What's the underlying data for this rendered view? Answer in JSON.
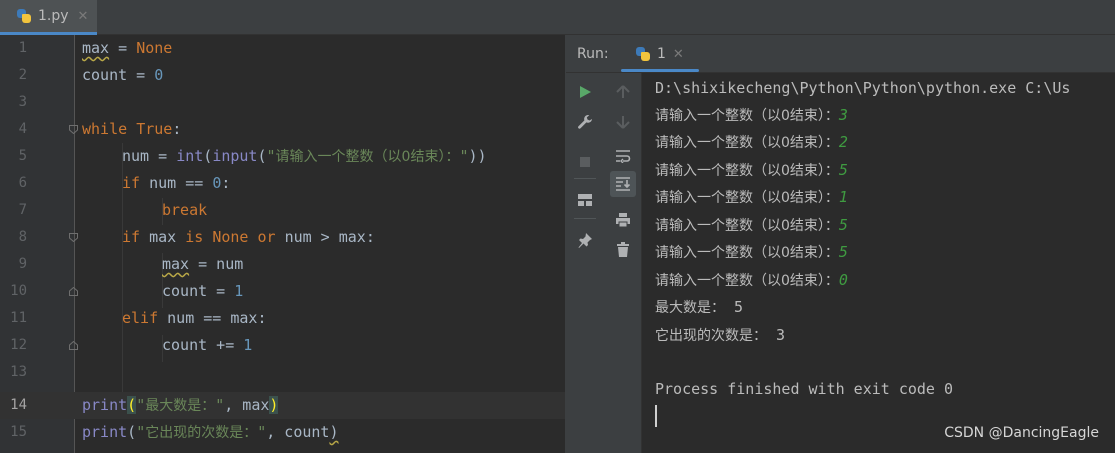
{
  "tab": {
    "filename": "1.py",
    "close": "✕"
  },
  "editor": {
    "lines": [
      {
        "n": "1"
      },
      {
        "n": "2"
      },
      {
        "n": "3"
      },
      {
        "n": "4"
      },
      {
        "n": "5"
      },
      {
        "n": "6"
      },
      {
        "n": "7"
      },
      {
        "n": "8"
      },
      {
        "n": "9"
      },
      {
        "n": "10"
      },
      {
        "n": "11"
      },
      {
        "n": "12"
      },
      {
        "n": "13"
      },
      {
        "n": "14"
      },
      {
        "n": "15"
      }
    ],
    "tokens": {
      "l1_var": "max",
      "l1_eq": " = ",
      "l1_none": "None",
      "l2_var": "count = ",
      "l2_zero": "0",
      "l4_while": "while ",
      "l4_true": "True",
      "l4_colon": ":",
      "l5_a": "num = ",
      "l5_int": "int",
      "l5_p1": "(",
      "l5_input": "input",
      "l5_p2": "(",
      "l5_q1": "\"",
      "l5_str": "请输入一个整数（以0结束）：",
      "l5_q2": "\"",
      "l5_end": "))",
      "l6_if": "if ",
      "l6_mid": "num == ",
      "l6_zero": "0",
      "l6_colon": ":",
      "l7_break": "break",
      "l8_if": "if ",
      "l8_max": "max ",
      "l8_is": "is ",
      "l8_none": "None ",
      "l8_or": "or ",
      "l8_rest": "num > max:",
      "l9_var": "max",
      "l9_rest": " = num",
      "l10_a": "count = ",
      "l10_one": "1",
      "l11_elif": "elif ",
      "l11_rest": "num == max:",
      "l12_a": "count += ",
      "l12_one": "1",
      "l14_print": "print",
      "l14_open": "(",
      "l14_q1": "\"",
      "l14_str": "最大数是：",
      "l14_q2": "\"",
      "l14_rest": ", max",
      "l14_close": ")",
      "l15_print": "print",
      "l15_open": "(",
      "l15_q1": "\"",
      "l15_str": "它出现的次数是：",
      "l15_q2": "\"",
      "l15_rest": ", count",
      "l15_close": ")"
    }
  },
  "run": {
    "label": "Run:",
    "tab_name": "1",
    "tab_close": "✕",
    "command": "D:\\shixikecheng\\Python\\Python\\python.exe C:\\Us",
    "prompt": "请输入一个整数（以0结束）：",
    "inputs": [
      "3",
      "2",
      "5",
      "1",
      "5",
      "5",
      "0"
    ],
    "max_label": "最大数是：",
    "max_value": " 5",
    "count_label": "它出现的次数是：",
    "count_value": " 3",
    "exit_message": "Process finished with exit code 0"
  },
  "watermark": "CSDN @DancingEagle",
  "colors": {
    "accent": "#4a88c7",
    "keyword": "#cc7832",
    "number": "#6897bb",
    "string": "#6a8759",
    "input": "#3f9b41",
    "run_green": "#59a869"
  },
  "icons": [
    "python-file-icon",
    "run-icon",
    "wrench-icon",
    "stop-icon",
    "layout-icon",
    "pin-icon",
    "up-arrow-icon",
    "down-arrow-icon",
    "soft-wrap-icon",
    "scroll-to-end-icon",
    "print-icon",
    "trash-icon"
  ]
}
